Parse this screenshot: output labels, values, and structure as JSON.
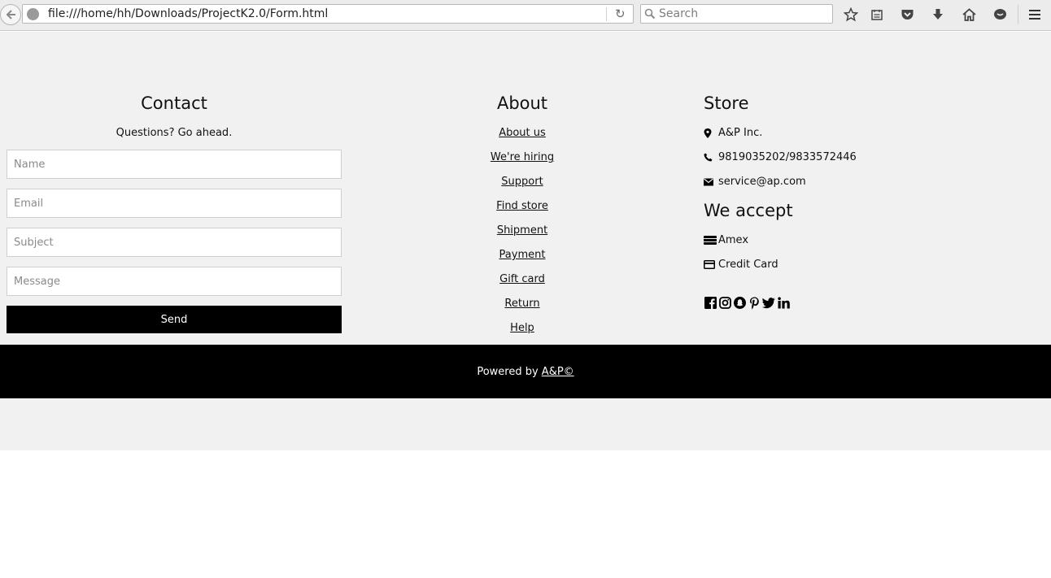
{
  "browser": {
    "url": "file:///home/hh/Downloads/ProjectK2.0/Form.html",
    "search_placeholder": "Search",
    "icons": [
      "back-icon",
      "globe-icon",
      "reload-icon",
      "search-icon",
      "bookmark-star-icon",
      "reading-list-icon",
      "pocket-icon",
      "download-icon",
      "home-icon",
      "chat-icon",
      "menu-icon"
    ]
  },
  "contact": {
    "title": "Contact",
    "subtitle": "Questions? Go ahead.",
    "fields": {
      "name": "Name",
      "email": "Email",
      "subject": "Subject",
      "message": "Message"
    },
    "send_label": "Send"
  },
  "about": {
    "title": "About",
    "links": [
      "About us",
      "We're hiring",
      "Support",
      "Find store",
      "Shipment",
      "Payment",
      "Gift card",
      "Return",
      "Help"
    ]
  },
  "store": {
    "title": "Store",
    "address": "A&P Inc.",
    "phone": "9819035202/9833572446",
    "email": "service@ap.com",
    "accept_title": "We accept",
    "payment_methods": [
      "Amex",
      "Credit Card"
    ],
    "social_icons": [
      "facebook-icon",
      "instagram-icon",
      "snapchat-icon",
      "pinterest-icon",
      "twitter-icon",
      "linkedin-icon"
    ]
  },
  "footer": {
    "prefix": "Powered by ",
    "link": "A&P©"
  },
  "colors": {
    "page_background": "#f1f1f1",
    "footer_background": "#000000",
    "button_background": "#000000"
  }
}
